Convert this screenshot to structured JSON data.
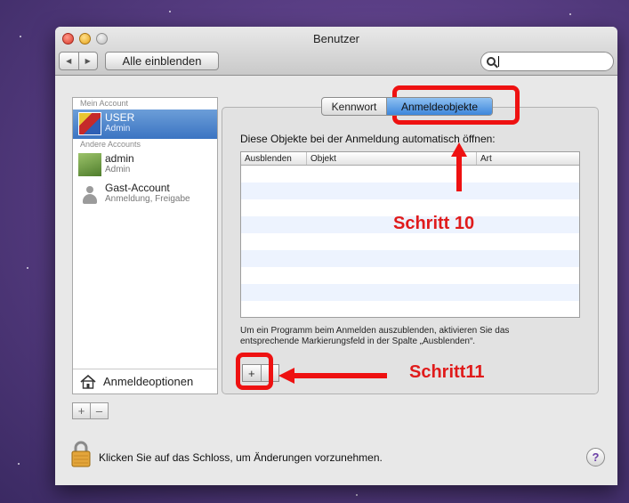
{
  "window": {
    "title": "Benutzer",
    "show_all_label": "Alle einblenden",
    "search_value": "",
    "back_glyph": "◀",
    "forward_glyph": "▶"
  },
  "sidebar": {
    "my_account_header": "Mein Account",
    "other_accounts_header": "Andere Accounts",
    "accounts": [
      {
        "name": "USER",
        "role": "Admin",
        "selected": true
      },
      {
        "name": "admin",
        "role": "Admin",
        "selected": false
      },
      {
        "name": "Gast-Account",
        "role": "Anmeldung, Freigabe",
        "selected": false
      }
    ],
    "login_options_label": "Anmeldeoptionen",
    "add_glyph": "+",
    "remove_glyph": "–"
  },
  "tabs": [
    {
      "label": "Kennwort",
      "selected": false
    },
    {
      "label": "Anmeldeobjekte",
      "selected": true
    }
  ],
  "login_items": {
    "description": "Diese Objekte bei der Anmeldung automatisch öffnen:",
    "columns": [
      "Ausblenden",
      "Objekt",
      "Art"
    ],
    "rows": [],
    "hint_line1": "Um ein Programm beim Anmelden auszublenden, aktivieren Sie das",
    "hint_line2": "entsprechende Markierungsfeld in der Spalte „Ausblenden“.",
    "add_glyph": "+",
    "remove_glyph": ""
  },
  "footer": {
    "lock_text": "Klicken Sie auf das Schloss, um Änderungen vorzunehmen.",
    "help_glyph": "?"
  },
  "annotations": {
    "step10": "Schritt 10",
    "step11": "Schritt11",
    "color": "#ee1111"
  }
}
